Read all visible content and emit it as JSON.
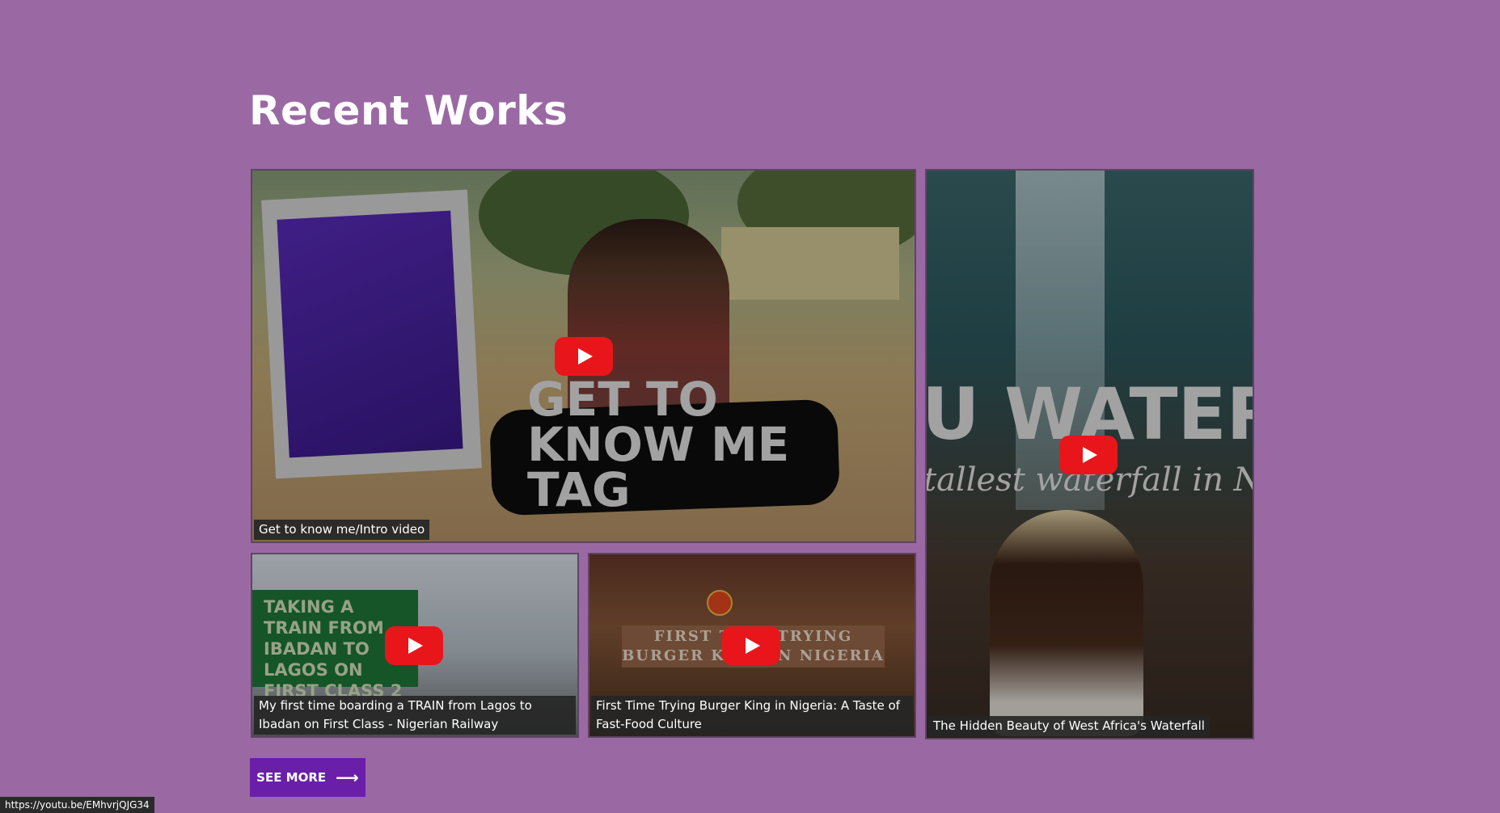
{
  "section": {
    "title": "Recent Works"
  },
  "videos": [
    {
      "caption": "Get to know me/Intro video",
      "thumbnail_text": "GET TO KNOW ME TAG"
    },
    {
      "caption": "My first time boarding a TRAIN from Lagos to Ibadan on First Class - Nigerian Railway",
      "thumbnail_text": "TAKING A TRAIN FROM IBADAN TO LAGOS ON FIRST CLASS 2"
    },
    {
      "caption": "First Time Trying Burger King in Nigeria: A Taste of Fast-Food Culture",
      "thumbnail_text": "FIRST TIME TRYING BURGER KING IN NIGERIA"
    },
    {
      "caption": "The Hidden Beauty of West Africa's Waterfall",
      "thumbnail_text": "U WATERI",
      "thumbnail_subtext": "tallest waterfall in Nig"
    }
  ],
  "see_more": {
    "label": "SEE MORE",
    "icon": "arrow-right-icon"
  },
  "status_bar": {
    "url": "https://youtu.be/EMhvrjQJG34"
  },
  "colors": {
    "background": "#9a69a3",
    "button": "#6a1fa8",
    "play_button": "#e8161a",
    "caption_bg": "#262626"
  }
}
